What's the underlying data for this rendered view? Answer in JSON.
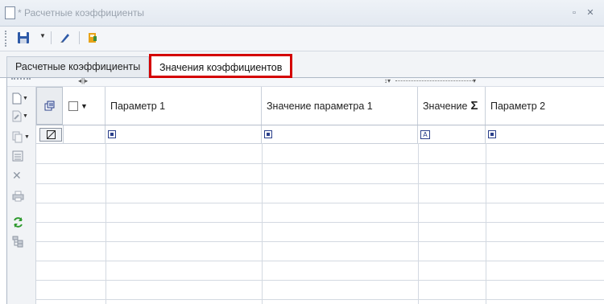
{
  "window": {
    "title": "* Расчетные коэффициенты"
  },
  "toolbar": {
    "icons": [
      "save-icon",
      "dropdown-arrow",
      "edit-pen-icon",
      "export-icon"
    ]
  },
  "tabs": [
    {
      "label": "Расчетные коэффициенты",
      "active": false
    },
    {
      "label": "Значения коэффициентов",
      "active": true
    }
  ],
  "grid": {
    "columns": [
      {
        "label": "Параметр 1"
      },
      {
        "label": "Значение параметра 1"
      },
      {
        "label": "Значение"
      },
      {
        "label": "Параметр 2"
      }
    ],
    "sum_symbol": "Σ",
    "filter_icon_letter": "A",
    "empty_rows": 8
  },
  "colors": {
    "highlight": "#d40000",
    "accent": "#2a3f8a"
  }
}
